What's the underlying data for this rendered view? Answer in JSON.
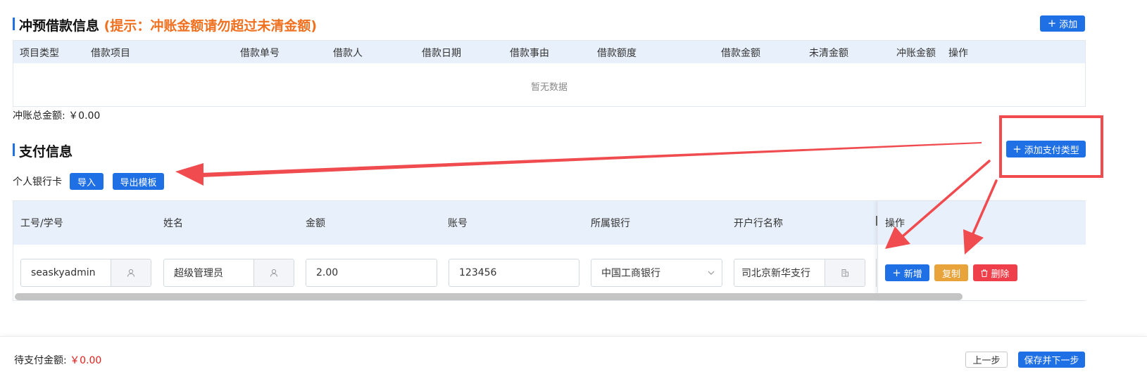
{
  "loan_section": {
    "title": "冲预借款信息",
    "hint": "(提示：冲账金额请勿超过未清金额)",
    "add_button": "添加",
    "columns": [
      "项目类型",
      "借款项目",
      "借款单号",
      "借款人",
      "借款日期",
      "借款事由",
      "借款额度",
      "借款金额",
      "未清金额",
      "冲账金额",
      "操作"
    ],
    "empty_text": "暂无数据",
    "total_label": "冲账总金额:",
    "total_value": "￥0.00"
  },
  "payment_section": {
    "title": "支付信息",
    "add_type_button": "添加支付类型",
    "card_type_label": "个人银行卡",
    "import_button": "导入",
    "export_button": "导出模板",
    "columns": [
      "工号/学号",
      "姓名",
      "金额",
      "账号",
      "所属银行",
      "开户行名称",
      "操作"
    ],
    "row": {
      "employee_id": "seaskyadmin",
      "name": "超级管理员",
      "amount": "2.00",
      "account": "123456",
      "bank": "中国工商银行",
      "branch": "司北京新华支行"
    },
    "row_actions": {
      "add": "新增",
      "copy": "复制",
      "delete": "删除"
    }
  },
  "footer": {
    "pending_label": "待支付金额:",
    "pending_value": "￥0.00",
    "prev_button": "上一步",
    "next_button": "保存并下一步"
  },
  "colors": {
    "primary": "#1f6fe5",
    "hint": "#f0701f",
    "annotation": "#f04b4f",
    "copy": "#e8a33a",
    "delete": "#ee3f4a",
    "money": "#e0201c"
  },
  "icons": [
    "plus-icon",
    "user-icon",
    "chevron-down-icon",
    "building-icon",
    "trash-icon"
  ]
}
